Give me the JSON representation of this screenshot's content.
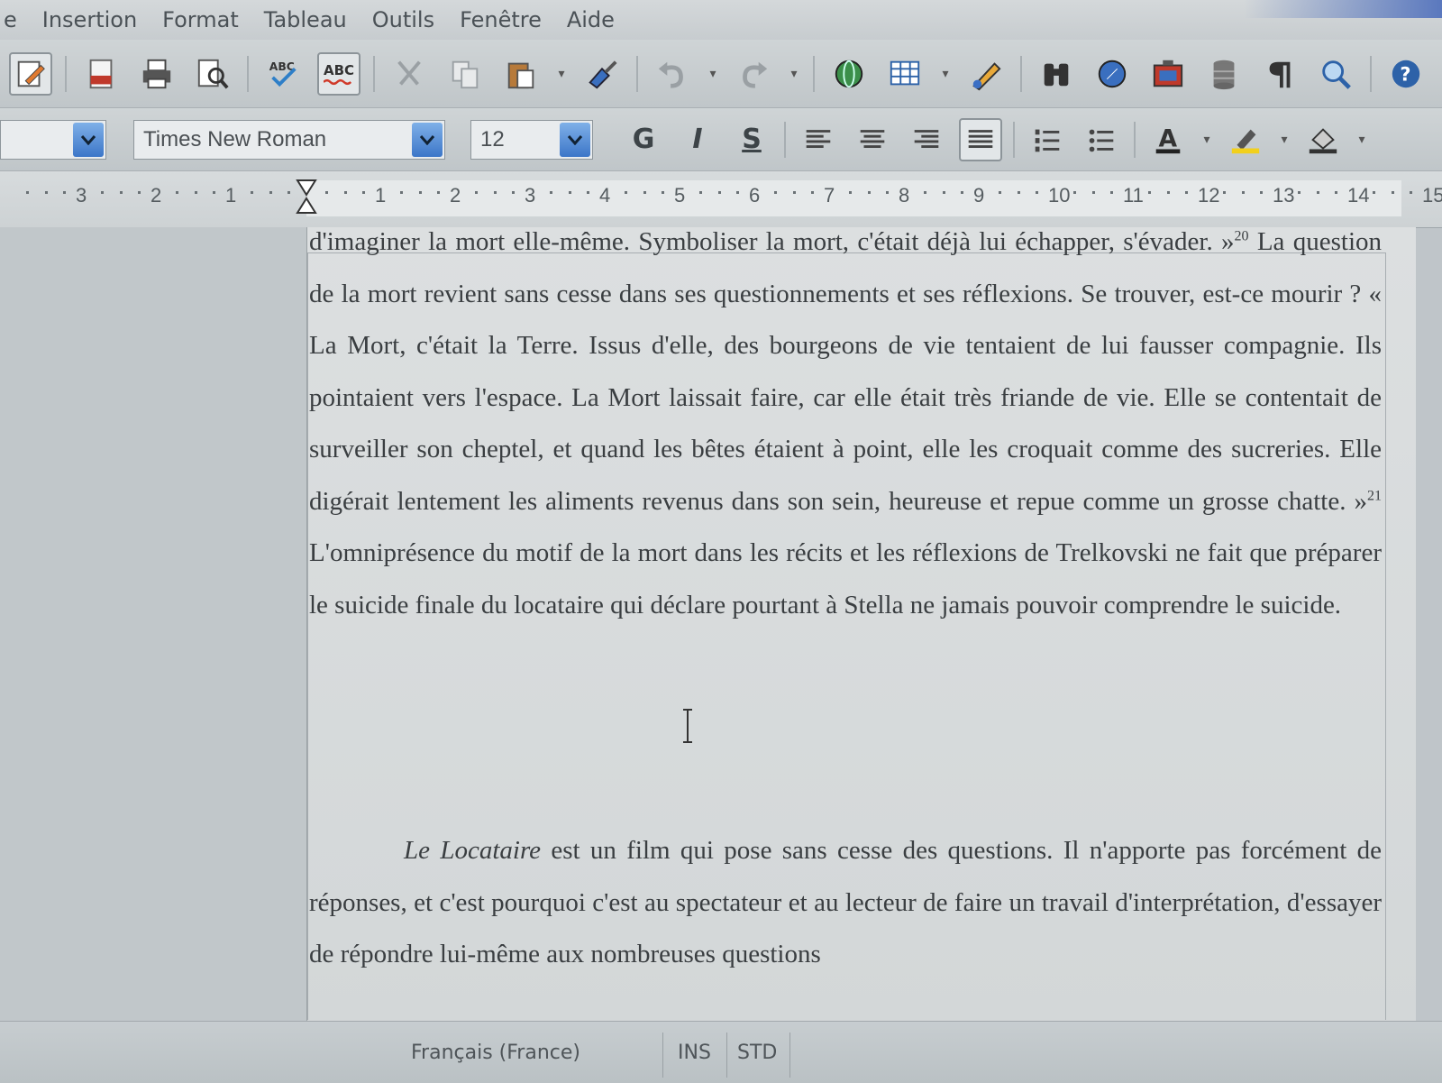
{
  "menu": {
    "items": [
      {
        "label": "e",
        "name": "edit"
      },
      {
        "label": "Insertion",
        "name": "insertion"
      },
      {
        "label": "Format",
        "name": "format"
      },
      {
        "label": "Tableau",
        "name": "tableau"
      },
      {
        "label": "Outils",
        "name": "outils"
      },
      {
        "label": "Fenêtre",
        "name": "fenetre"
      },
      {
        "label": "Aide",
        "name": "aide"
      }
    ]
  },
  "toolbar_format": {
    "style_value": "",
    "font_name": "Times New Roman",
    "font_size": "12",
    "bold_label": "G",
    "italic_label": "I",
    "underline_label": "S"
  },
  "spellcheck_label": "ABC",
  "ruler": {
    "labels": [
      "3",
      "2",
      "1",
      "1",
      "2",
      "3",
      "4",
      "5",
      "6",
      "7",
      "8",
      "9",
      "10",
      "11",
      "12",
      "13",
      "14",
      "15"
    ]
  },
  "document": {
    "para1_text": "d'imaginer la mort elle-même. Symboliser la mort, c'était déjà lui échapper, s'évader. »",
    "para1_note": "20",
    "para1_cont": " La question de la mort revient sans cesse dans ses questionnements et ses réflexions. Se trouver, est-ce mourir ? « La Mort, c'était la Terre. Issus d'elle, des bourgeons de vie tentaient de lui fausser compagnie. Ils pointaient vers l'espace. La Mort laissait faire, car elle était très friande de vie. Elle se contentait de surveiller son cheptel, et quand les bêtes étaient à point, elle les croquait comme des sucreries. Elle digérait lentement les aliments revenus dans son sein, heureuse et repue comme un grosse chatte. »",
    "para1_note2": "21",
    "para1_end": " L'omniprésence du motif de la mort dans les récits et les réflexions de Trelkovski ne fait que préparer le suicide finale du locataire qui déclare pourtant à Stella ne jamais pouvoir comprendre le suicide.",
    "para2_title": "Le Locataire",
    "para2_text": " est un film qui pose sans cesse des questions. Il n'apporte pas forcément de réponses, et c'est pourquoi c'est au spectateur et au lecteur de faire un travail d'interprétation, d'essayer de répondre lui-même aux nombreuses questions"
  },
  "status": {
    "language": "Français (France)",
    "insert_mode": "INS",
    "selection_mode": "STD"
  },
  "icons": [
    "edit-file-icon",
    "export-pdf-icon",
    "print-icon",
    "page-preview-icon",
    "spellcheck-icon",
    "autospellcheck-icon",
    "cut-icon",
    "copy-icon",
    "paste-icon",
    "format-paintbrush-icon",
    "undo-icon",
    "redo-icon",
    "hyperlink-icon",
    "table-icon",
    "draw-functions-icon",
    "find-replace-icon",
    "navigator-icon",
    "gallery-icon",
    "data-sources-icon",
    "pilcrow-icon",
    "zoom-icon",
    "help-icon"
  ],
  "colors": {
    "accent": "#3c76c8",
    "toolbar": "#c7cccf",
    "text": "#3a3e41"
  }
}
